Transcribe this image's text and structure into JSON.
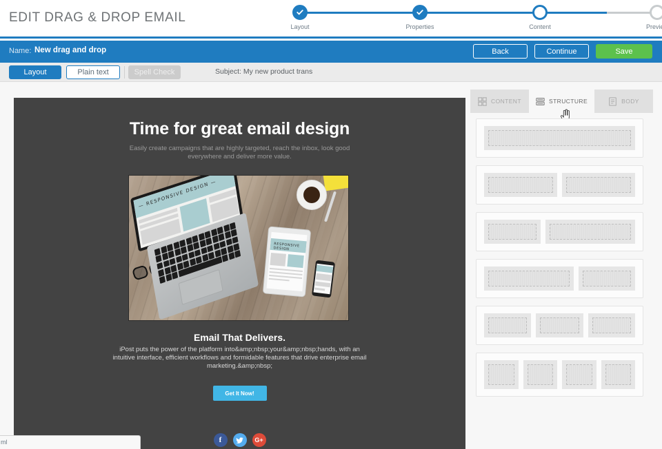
{
  "header": {
    "page_title": "EDIT DRAG & DROP EMAIL",
    "accent_blue": "#1f7cc0",
    "steps": [
      {
        "label": "Layout",
        "state": "done"
      },
      {
        "label": "Properties",
        "state": "done"
      },
      {
        "label": "Content",
        "state": "current"
      },
      {
        "label": "Preview",
        "state": "future"
      }
    ]
  },
  "blue_bar": {
    "name_label": "Name:",
    "name_value": "New drag and drop",
    "back_label": "Back",
    "continue_label": "Continue",
    "save_label": "Save",
    "save_color": "#5cc14c"
  },
  "toolbar": {
    "layout_label": "Layout",
    "plain_text_label": "Plain text",
    "spell_check_label": "Spell Check",
    "subject_text": "Subject: My new product trans"
  },
  "email": {
    "background": "#434343",
    "heading": "Time for great email design",
    "subheading": "Easily create campaigns that are highly targeted, reach the inbox, look good everywhere and deliver more value.",
    "photo_alt": "RESPONSIVE DESIGN",
    "photo_caption_laptop": "— RESPONSIVE DESIGN —",
    "photo_caption_tablet": "RESPONSIVE DESIGN",
    "section_heading": "Email That Delivers.",
    "body_text": "iPost puts the power of the platform into&amp;nbsp;your&amp;nbsp;hands, with an intuitive interface, efficient workflows and formidable features that drive enterprise email marketing.&amp;nbsp;",
    "cta_label": "Get It Now!",
    "cta_color": "#41b6e6",
    "social": [
      {
        "name": "facebook",
        "glyph": "f",
        "color": "#3b5998"
      },
      {
        "name": "twitter",
        "glyph": "✐",
        "color": "#55acee"
      },
      {
        "name": "googleplus",
        "glyph": "G+",
        "color": "#dd4b39"
      }
    ]
  },
  "right_panel": {
    "tabs": [
      {
        "label": "CONTENT",
        "icon": "grid-icon",
        "active": false
      },
      {
        "label": "STRUCTURE",
        "icon": "rows-icon",
        "active": true
      },
      {
        "label": "BODY",
        "icon": "document-icon",
        "active": false
      }
    ],
    "structures": [
      {
        "name": "one-column",
        "columns": [
          1
        ]
      },
      {
        "name": "two-column-equal",
        "columns": [
          1,
          1
        ]
      },
      {
        "name": "two-column-narrow-wide",
        "columns": [
          1,
          2
        ]
      },
      {
        "name": "two-column-wide-narrow",
        "columns": [
          2,
          1
        ]
      },
      {
        "name": "three-column-equal",
        "columns": [
          1,
          1,
          1
        ]
      },
      {
        "name": "four-column-equal",
        "columns": [
          1,
          1,
          1,
          1
        ]
      }
    ]
  },
  "download_bar": {
    "filename_fragment": "ml"
  }
}
